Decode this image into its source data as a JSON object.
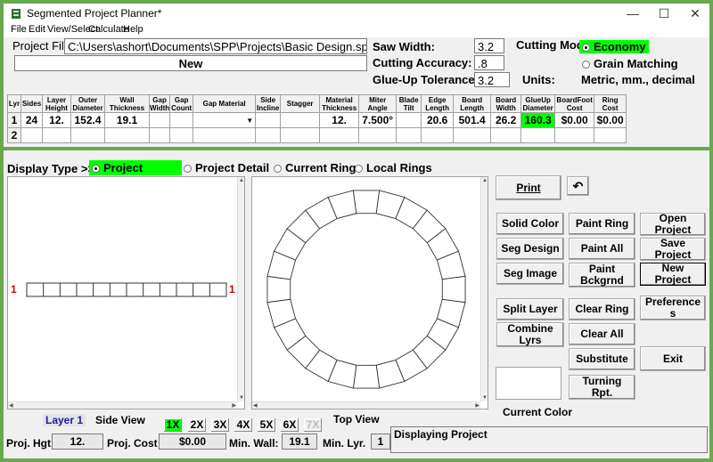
{
  "window": {
    "title": "Segmented Project Planner*",
    "minimize": "—",
    "maximize": "☐",
    "close": "✕"
  },
  "menu": [
    "File",
    "Edit",
    "View/Select",
    "Calculate",
    "Help"
  ],
  "project": {
    "file_label": "Project File",
    "file_path": "C:\\Users\\ashort\\Documents\\SPP\\Projects\\Basic Design.spr",
    "name": "New"
  },
  "settings": {
    "saw_width_label": "Saw Width:",
    "saw_width": "3.2",
    "cutting_accuracy_label": "Cutting Accuracy:",
    "cutting_accuracy": ".8",
    "glue_up_label": "Glue-Up Tolerance:",
    "glue_up": "3.2",
    "cutting_mode_label": "Cutting Mode",
    "mode_economy": "Economy",
    "mode_grain": "Grain Matching",
    "units_label": "Units:",
    "units_value": "Metric, mm., decimal"
  },
  "grid": {
    "headers": [
      "Lyr",
      "Sides",
      "Layer Height",
      "Outer Diameter",
      "Wall Thickness",
      "Gap Width",
      "Gap Count",
      "Gap Material",
      "Side Incline",
      "Stagger",
      "Material Thickness",
      "Miter Angle",
      "Blade Tilt",
      "Edge Length",
      "Board Length",
      "Board Width",
      "GlueUp Diameter",
      "BoardFoot Cost",
      "Ring Cost"
    ],
    "rows": [
      [
        "1",
        "24",
        "12.",
        "152.4",
        "19.1",
        "",
        "",
        "",
        "",
        "",
        "12.",
        "7.500°",
        "",
        "20.6",
        "501.4",
        "26.2",
        "160.3",
        "$0.00",
        "$0.00"
      ],
      [
        "2",
        "",
        "",
        "",
        "",
        "",
        "",
        "",
        "",
        "",
        "",
        "",
        "",
        "",
        "",
        "",
        "",
        "",
        ""
      ]
    ]
  },
  "display": {
    "label": "Display Type >>",
    "opt_outline": "Project Outline",
    "opt_detail": "Project Detail",
    "opt_current": "Current Ring",
    "opt_local": "Local Rings"
  },
  "side_view": {
    "marker_left": "1",
    "marker_right": "1",
    "segments": 12
  },
  "top_view": {
    "segments": 24
  },
  "buttons": {
    "print": "Print",
    "undo": "↶",
    "solid_color": "Solid Color",
    "seg_design": "Seg Design",
    "seg_image": "Seg Image",
    "paint_ring": "Paint Ring",
    "paint_all": "Paint All",
    "paint_bckgrnd": "Paint Bckgrnd",
    "open_project": "Open Project",
    "save_project": "Save Project",
    "new_project": "New Project",
    "split_layer": "Split Layer",
    "combine_lyrs": "Combine Lyrs",
    "clear_ring": "Clear Ring",
    "clear_all": "Clear All",
    "preferences": "Preference s",
    "substitute": "Substitute",
    "exit": "Exit",
    "turning_rpt": "Turning Rpt."
  },
  "current_color_label": "Current Color",
  "bottom": {
    "layer_label": "Layer 1",
    "side_view_label": "Side View",
    "zoom": [
      "1X",
      "2X",
      "3X",
      "4X",
      "5X",
      "6X",
      "7X"
    ],
    "top_view_label": "Top View",
    "proj_hgt_label": "Proj. Hgt",
    "proj_hgt": "12.",
    "proj_cost_label": "Proj. Cost",
    "proj_cost": "$0.00",
    "min_wall_label": "Min. Wall:",
    "min_wall": "19.1",
    "min_lyr_label": "Min. Lyr.",
    "min_lyr": "1",
    "status": "Displaying Project"
  },
  "colors": {
    "accent_green": "#00ff00",
    "frame_green": "#6aa84f",
    "layer_label": "#1a1aa0",
    "marker_red": "#cc0000"
  }
}
